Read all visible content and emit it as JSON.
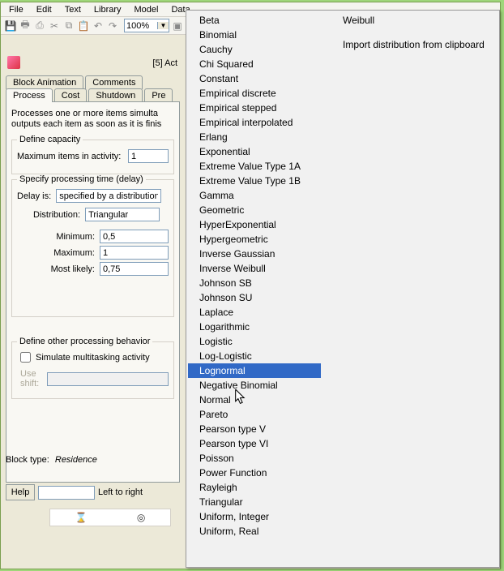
{
  "menu": {
    "items": [
      "File",
      "Edit",
      "Text",
      "Library",
      "Model",
      "Data"
    ]
  },
  "toolbar": {
    "zoom": "100%"
  },
  "inner_title": "[5]   Act",
  "tabs_row1": {
    "items": [
      "Block Animation",
      "Comments"
    ]
  },
  "tabs_row2": {
    "items": [
      "Process",
      "Cost",
      "Shutdown",
      "Pre"
    ]
  },
  "description": "Processes one or more items simulta\noutputs each item as soon as it is finis",
  "fs_capacity": {
    "legend": "Define capacity",
    "max_label": "Maximum items in activity:",
    "max_value": "1"
  },
  "fs_delay": {
    "legend": "Specify processing time (delay)",
    "delay_is_label": "Delay is:",
    "delay_is_value": "specified by a distribution.",
    "distribution_label": "Distribution:",
    "distribution_value": "Triangular",
    "min_label": "Minimum:",
    "min_value": "0,5",
    "max_label": "Maximum:",
    "max_value": "1",
    "most_label": "Most likely:",
    "most_value": "0,75"
  },
  "fs_other": {
    "legend": "Define other processing behavior",
    "simulate_label": "Simulate multitasking activity",
    "use_shift_label": "Use shift:"
  },
  "block_type_label": "Block type:",
  "block_type_value": "Residence",
  "help_button": "Help",
  "left_to_right": "Left to right",
  "dropdown": {
    "col1": [
      "Beta",
      "Binomial",
      "Cauchy",
      "Chi Squared",
      "Constant",
      "Empirical discrete",
      "Empirical stepped",
      "Empirical interpolated",
      "Erlang",
      "Exponential",
      "Extreme Value Type 1A",
      "Extreme Value Type 1B",
      "Gamma",
      "Geometric",
      "HyperExponential",
      "Hypergeometric",
      "Inverse Gaussian",
      "Inverse Weibull",
      "Johnson SB",
      "Johnson SU",
      "Laplace",
      "Logarithmic",
      "Logistic",
      "Log-Logistic",
      "Lognormal",
      "Negative Binomial",
      "Normal",
      "Pareto",
      "Pearson type V",
      "Pearson type VI",
      "Poisson",
      "Power Function",
      "Rayleigh",
      "Triangular",
      "Uniform, Integer",
      "Uniform, Real"
    ],
    "col2": [
      "Weibull",
      "Import distribution from clipboard"
    ],
    "highlight_index": 24
  }
}
